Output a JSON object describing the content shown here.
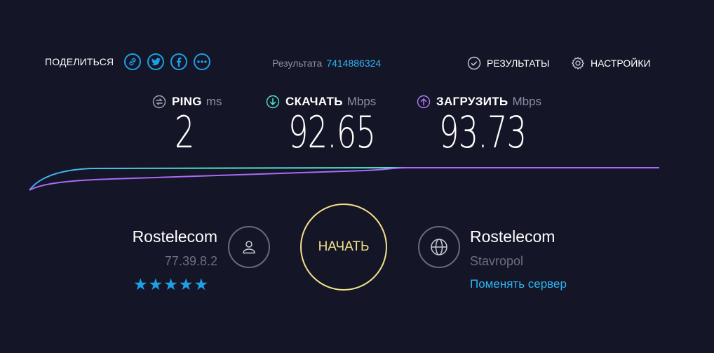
{
  "share": {
    "label": "ПОДЕЛИТЬСЯ",
    "icons": [
      "link-icon",
      "twitter-icon",
      "facebook-icon",
      "more-icon"
    ]
  },
  "result": {
    "label": "Результата",
    "id": "7414886324"
  },
  "nav": {
    "results_label": "РЕЗУЛЬТАТЫ",
    "settings_label": "НАСТРОЙКИ"
  },
  "metrics": {
    "ping": {
      "label": "PING",
      "unit": "ms",
      "value": "2"
    },
    "download": {
      "label": "СКАЧАТЬ",
      "unit": "Mbps",
      "value": "92.65"
    },
    "upload": {
      "label": "ЗАГРУЗИТЬ",
      "unit": "Mbps",
      "value": "93.73"
    }
  },
  "isp": {
    "name": "Rostelecom",
    "ip": "77.39.8.2",
    "rating_stars": 5,
    "stars_text": "★★★★★"
  },
  "start_button": {
    "label": "НАЧАТЬ"
  },
  "server": {
    "name": "Rostelecom",
    "city": "Stavropol",
    "change_label": "Поменять сервер"
  },
  "colors": {
    "background": "#141526",
    "accent_blue": "#1ea0e6",
    "download_teal": "#4fe3c9",
    "upload_purple": "#a96bf5",
    "start_yellow": "#f0e28a"
  }
}
